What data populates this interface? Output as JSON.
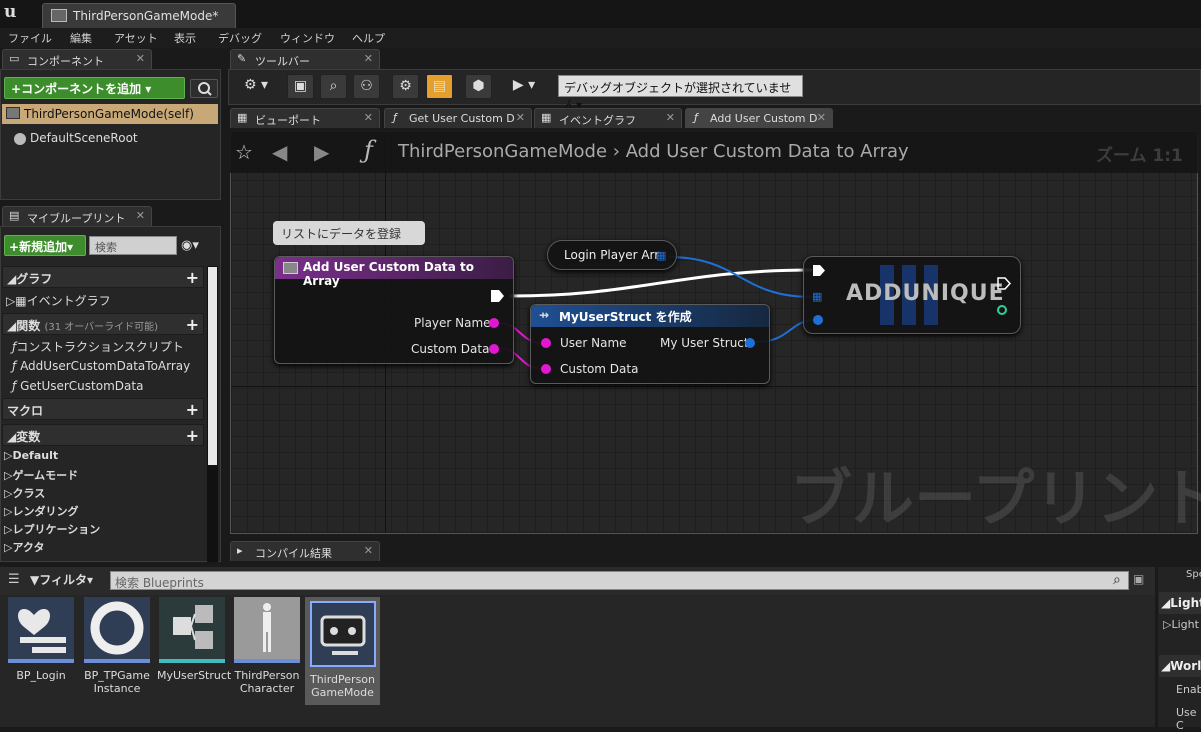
{
  "window": {
    "tab_title": "ThirdPersonGameMode*"
  },
  "menu": [
    "ファイル",
    "編集",
    "アセット",
    "表示",
    "デバッグ",
    "ウィンドウ",
    "ヘルプ"
  ],
  "components": {
    "tab": "コンポーネント",
    "add_button": "コンポーネントを追加",
    "root": "ThirdPersonGameMode(self)",
    "child": "DefaultSceneRoot"
  },
  "my_blueprint": {
    "tab": "マイブループリント",
    "new_add": "新規追加",
    "search_placeholder": "検索",
    "graph_header": "グラフ",
    "event_graph": "イベントグラフ",
    "functions_header": "関数",
    "functions_note": "(31 オーバーライド可能)",
    "functions": [
      "コンストラクションスクリプト",
      "AddUserCustomDataToArray",
      "GetUserCustomData"
    ],
    "macro_header": "マクロ",
    "variables_header": "変数",
    "categories": [
      "Default",
      "ゲームモード",
      "クラス",
      "レンダリング",
      "レプリケーション",
      "アクタ"
    ]
  },
  "toolbar": {
    "tab": "ツールバー",
    "debug_object": "デバッグオブジェクトが選択されていません"
  },
  "graph_tabs": [
    "ビューポート",
    "Get User Custom D",
    "イベントグラフ",
    "Add User Custom D"
  ],
  "graph": {
    "breadcrumb_root": "ThirdPersonGameMode",
    "breadcrumb_leaf": "Add User Custom Data to Array",
    "zoom": "ズーム 1:1",
    "watermark": "ブループリント",
    "comment": "リストにデータを登録",
    "entry_node": {
      "title": "Add User Custom Data to Array",
      "pins": [
        "Player Name",
        "Custom Data"
      ]
    },
    "var_node": {
      "label": "Login Player Arr"
    },
    "make_node": {
      "title": "MyUserStruct を作成",
      "inputs": [
        "User Name",
        "Custom Data"
      ],
      "output": "My User Struct"
    },
    "add_node": {
      "title": "ADDUNIQUE"
    }
  },
  "compile": {
    "tab": "コンパイル結果"
  },
  "content_browser": {
    "filter": "フィルタ",
    "search_placeholder": "検索 Blueprints",
    "assets": [
      {
        "line1": "BP_Login",
        "line2": ""
      },
      {
        "line1": "BP_TPGame",
        "line2": "Instance"
      },
      {
        "line1": "MyUserStruct",
        "line2": ""
      },
      {
        "line1": "ThirdPerson",
        "line2": "Character"
      },
      {
        "line1": "ThirdPerson",
        "line2": "GameMode"
      }
    ]
  },
  "details": {
    "items": [
      "Spe",
      "Light",
      "Light",
      "World",
      "Enab",
      "Use C"
    ]
  },
  "colors": {
    "accent_green": "#3d8d2c",
    "pin_magenta": "#e317d2",
    "exec_white": "#ffffff",
    "struct_blue": "#1f6fd8",
    "function_header": "#6a2a7a",
    "make_header": "#1e4a8a"
  }
}
